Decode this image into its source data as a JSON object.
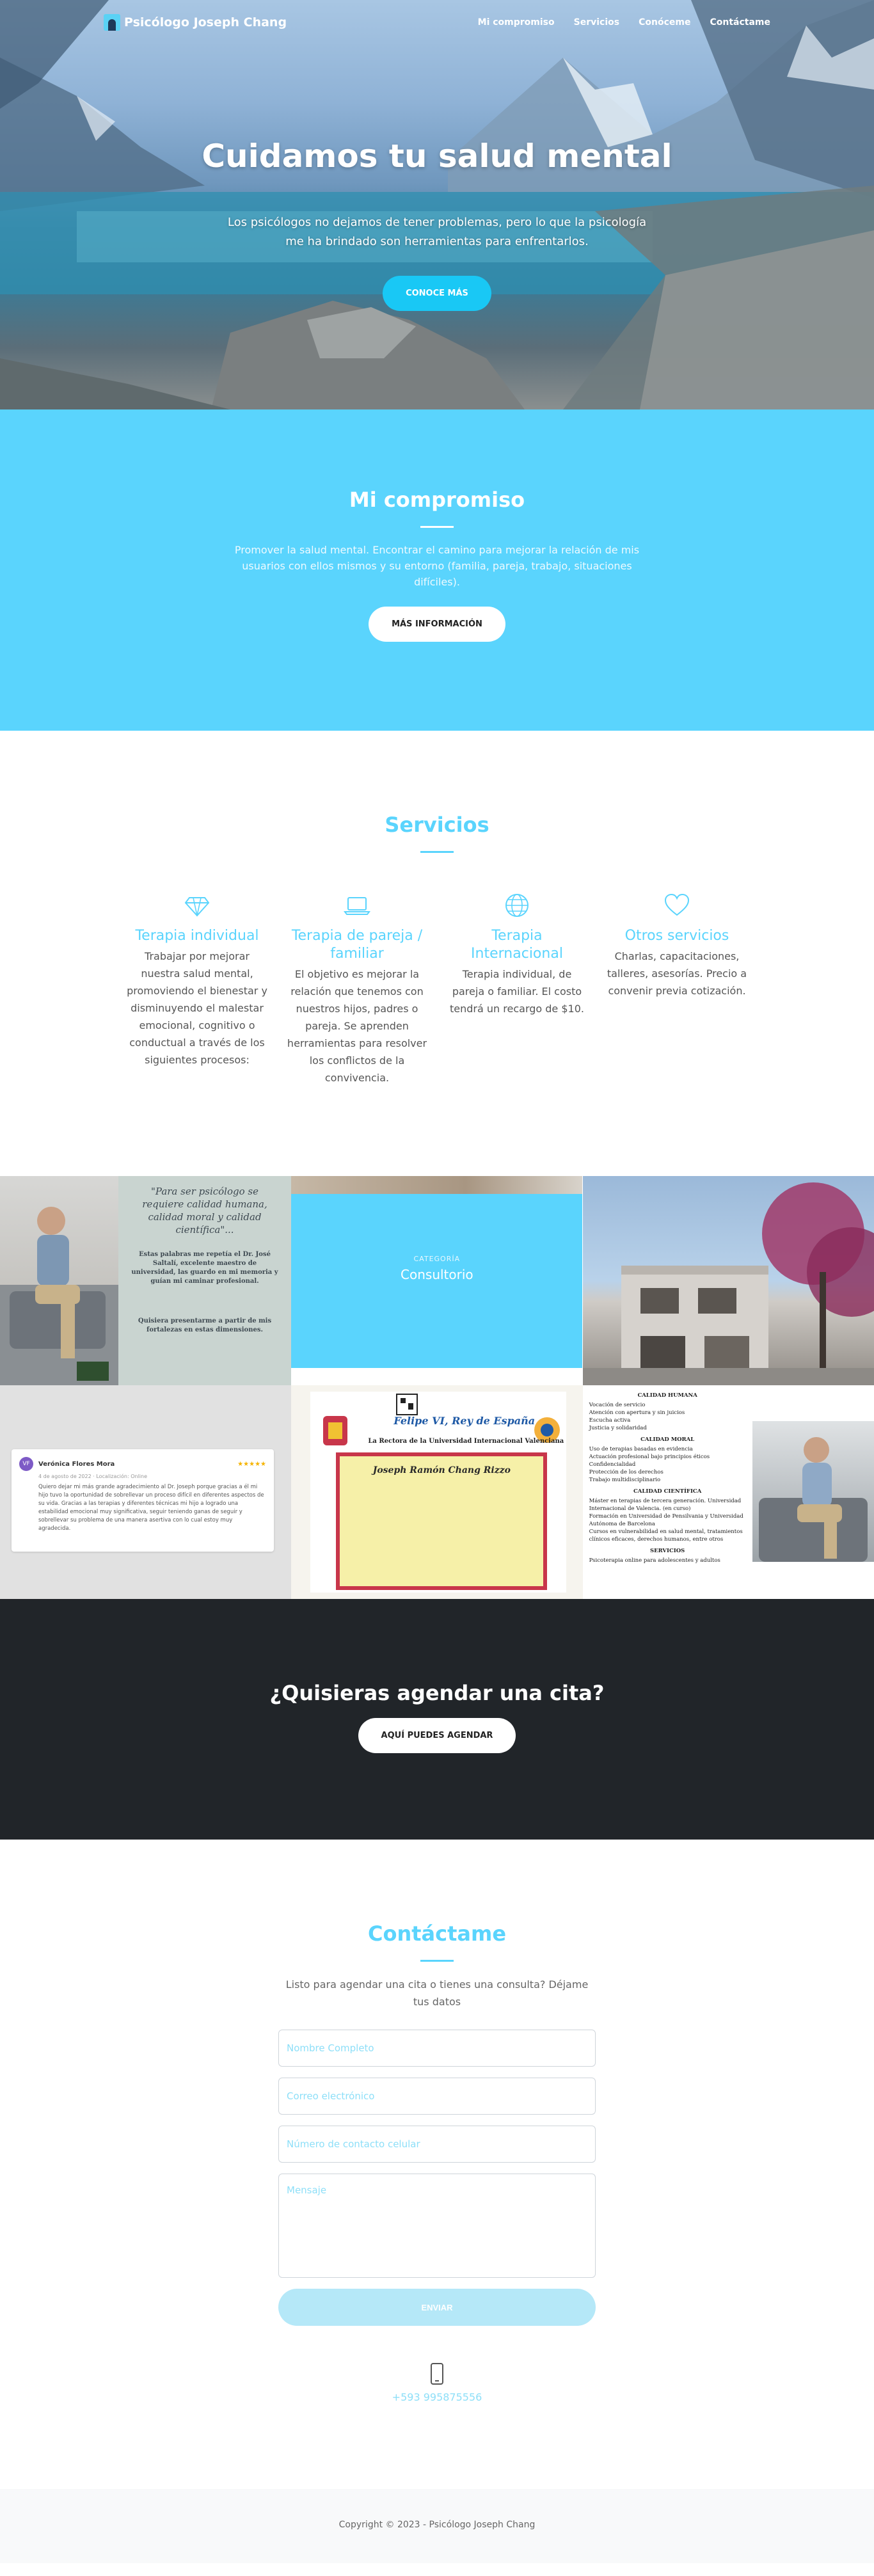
{
  "nav": {
    "brand": "Psicólogo Joseph Chang",
    "links": [
      "Mi compromiso",
      "Servicios",
      "Conóceme",
      "Contáctame"
    ]
  },
  "hero": {
    "title": "Cuidamos tu salud mental",
    "subtitle": "Los psicólogos no dejamos de tener problemas, pero lo que la psicología me ha brindado son herramientas para enfrentarlos.",
    "button": "CONOCE MÁS"
  },
  "commitment": {
    "title": "Mi compromiso",
    "text": "Promover la salud mental. Encontrar el camino para mejorar la relación de mis usuarios con ellos mismos y su entorno (familia, pareja, trabajo, situaciones difíciles).",
    "button": "MÁS INFORMACIÓN"
  },
  "services": {
    "title": "Servicios",
    "items": [
      {
        "icon": "diamond-icon",
        "title": "Terapia individual",
        "text": "Trabajar por mejorar nuestra salud mental, promoviendo el bienestar y disminuyendo el malestar emocional, cognitivo o conductual a través de los siguientes procesos:"
      },
      {
        "icon": "laptop-icon",
        "title": "Terapia de pareja / familiar",
        "text": "El objetivo es mejorar la relación que tenemos con nuestros hijos, padres o pareja. Se aprenden herramientas para resolver los conflictos de la convivencia."
      },
      {
        "icon": "globe-icon",
        "title": "Terapia Internacional",
        "text": "Terapia individual, de pareja o familiar. El costo tendrá un recargo de $10."
      },
      {
        "icon": "heart-icon",
        "title": "Otros servicios",
        "text": "Charlas, capacitaciones, talleres, asesorías. Precio a convenir previa cotización."
      }
    ]
  },
  "gallery": {
    "quote": "\"Para ser psicólogo se requiere calidad humana, calidad moral y calidad científica\"...",
    "quote_detail": "Estas palabras me repetía el Dr. José Saltalí, excelente maestro de universidad, las guardo en mi memoria y guían mi caminar profesional.",
    "quote_footer": "Quisiera presentarme a partir de mis fortalezas en estas dimensiones.",
    "category_label": "CATEGORÍA",
    "category_value": "Consultorio",
    "review": {
      "avatar": "VF",
      "name": "Verónica Flores Mora",
      "stars": "★★★★★",
      "date": "4 de agosto de 2022 · Localización: Online",
      "text": "Quiero dejar mi más grande agradecimiento al Dr. Joseph porque gracias a él mi hijo tuvo la oportunidad de sobrellevar un proceso difícil en diferentes aspectos de su vida. Gracias a las terapias y diferentes técnicas mi hijo a logrado una estabilidad emocional muy significativa, seguir teniendo ganas de seguir y sobrellevar su problema de una manera asertiva con lo cual estoy muy agradecida."
    },
    "certificate": {
      "king": "Felipe VI, Rey de España",
      "university": "La Rectora de la Universidad Internacional Valenciana",
      "name": "Joseph Ramón Chang Rizzo"
    },
    "doc": {
      "h1": "CALIDAD HUMANA",
      "items1": [
        "Vocación de servicio",
        "Atención con apertura y sin juicios",
        "Escucha activa",
        "Justicia y solidaridad"
      ],
      "h2": "CALIDAD MORAL",
      "items2": [
        "Uso de terapias basadas en evidencia",
        "Actuación profesional bajo principios éticos",
        "Confidencialidad",
        "Protección de los derechos",
        "Trabajo multidisciplinario"
      ],
      "h3": "CALIDAD CIENTÍFICA",
      "items3": [
        "Máster en terapias de tercera generación. Universidad Internacional de Valencia. (en curso)",
        "Formación en Universidad de Pensilvania y Universidad Autónoma de Barcelona",
        "Cursos en vulnerabilidad en salud mental, tratamientos clínicos eficaces, derechos humanos, entre otros"
      ],
      "h4": "SERVICIOS",
      "items4": [
        "Psicoterapia online para adolescentes y adultos"
      ]
    }
  },
  "appointment": {
    "title": "¿Quisieras agendar una cita?",
    "button": "AQUÍ PUEDES AGENDAR"
  },
  "contact": {
    "title": "Contáctame",
    "lead": "Listo para agendar una cita o tienes una consulta? Déjame tus datos",
    "name_placeholder": "Nombre Completo",
    "email_placeholder": "Correo electrónico",
    "phone_placeholder": "Número de contacto celular",
    "message_placeholder": "Mensaje",
    "submit": "ENVIAR",
    "phone": "+593 995875556"
  },
  "footer": {
    "copyright": "Copyright © 2023 - Psicólogo Joseph Chang"
  },
  "colors": {
    "accent": "#5ad4fd",
    "hero_button": "#19c8f5",
    "dark": "#212529"
  }
}
